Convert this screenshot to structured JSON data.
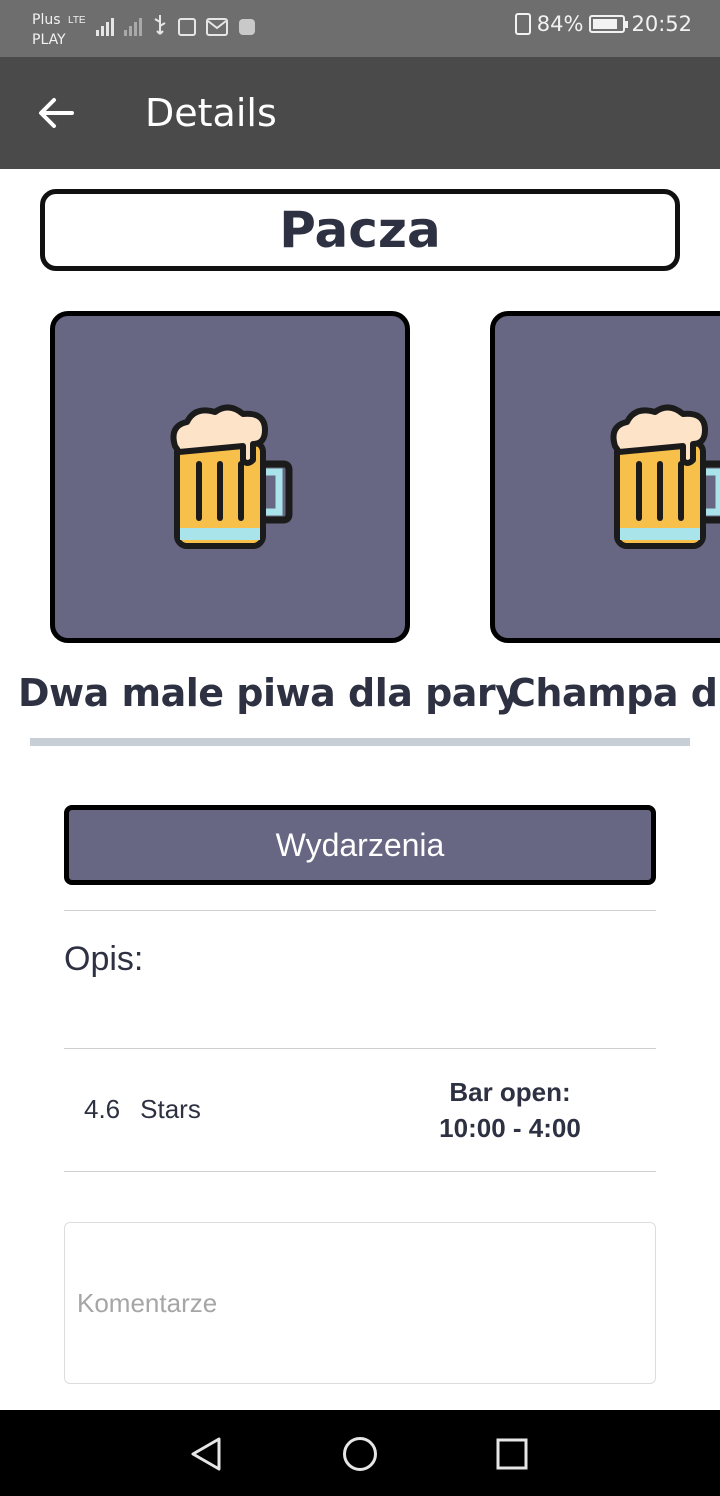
{
  "status_bar": {
    "carrier_top": "Plus",
    "carrier_bottom": "PLAY",
    "network": "LTE",
    "battery": "84%",
    "time": "20:52"
  },
  "app_bar": {
    "back_icon": "arrow-left-icon",
    "title": "Details"
  },
  "venue": {
    "name": "Pacza"
  },
  "promotions": [
    {
      "title": "Dwa male piwa dla pary",
      "icon": "beer-mug-icon"
    },
    {
      "title": "Champa dla",
      "icon": "beer-mug-icon"
    }
  ],
  "events_button": "Wydarzenia",
  "description": {
    "label": "Opis:"
  },
  "rating": {
    "value": "4.6",
    "unit": "Stars"
  },
  "hours": {
    "label": "Bar open:",
    "value": "10:00 - 4:00"
  },
  "comments": {
    "placeholder": "Komentarze"
  },
  "colors": {
    "accent": "#676683",
    "text": "#2d3142",
    "app_bar": "#4a4a4a"
  },
  "nav_bar": {
    "back": "triangle-back-icon",
    "home": "circle-home-icon",
    "recents": "square-recents-icon"
  }
}
